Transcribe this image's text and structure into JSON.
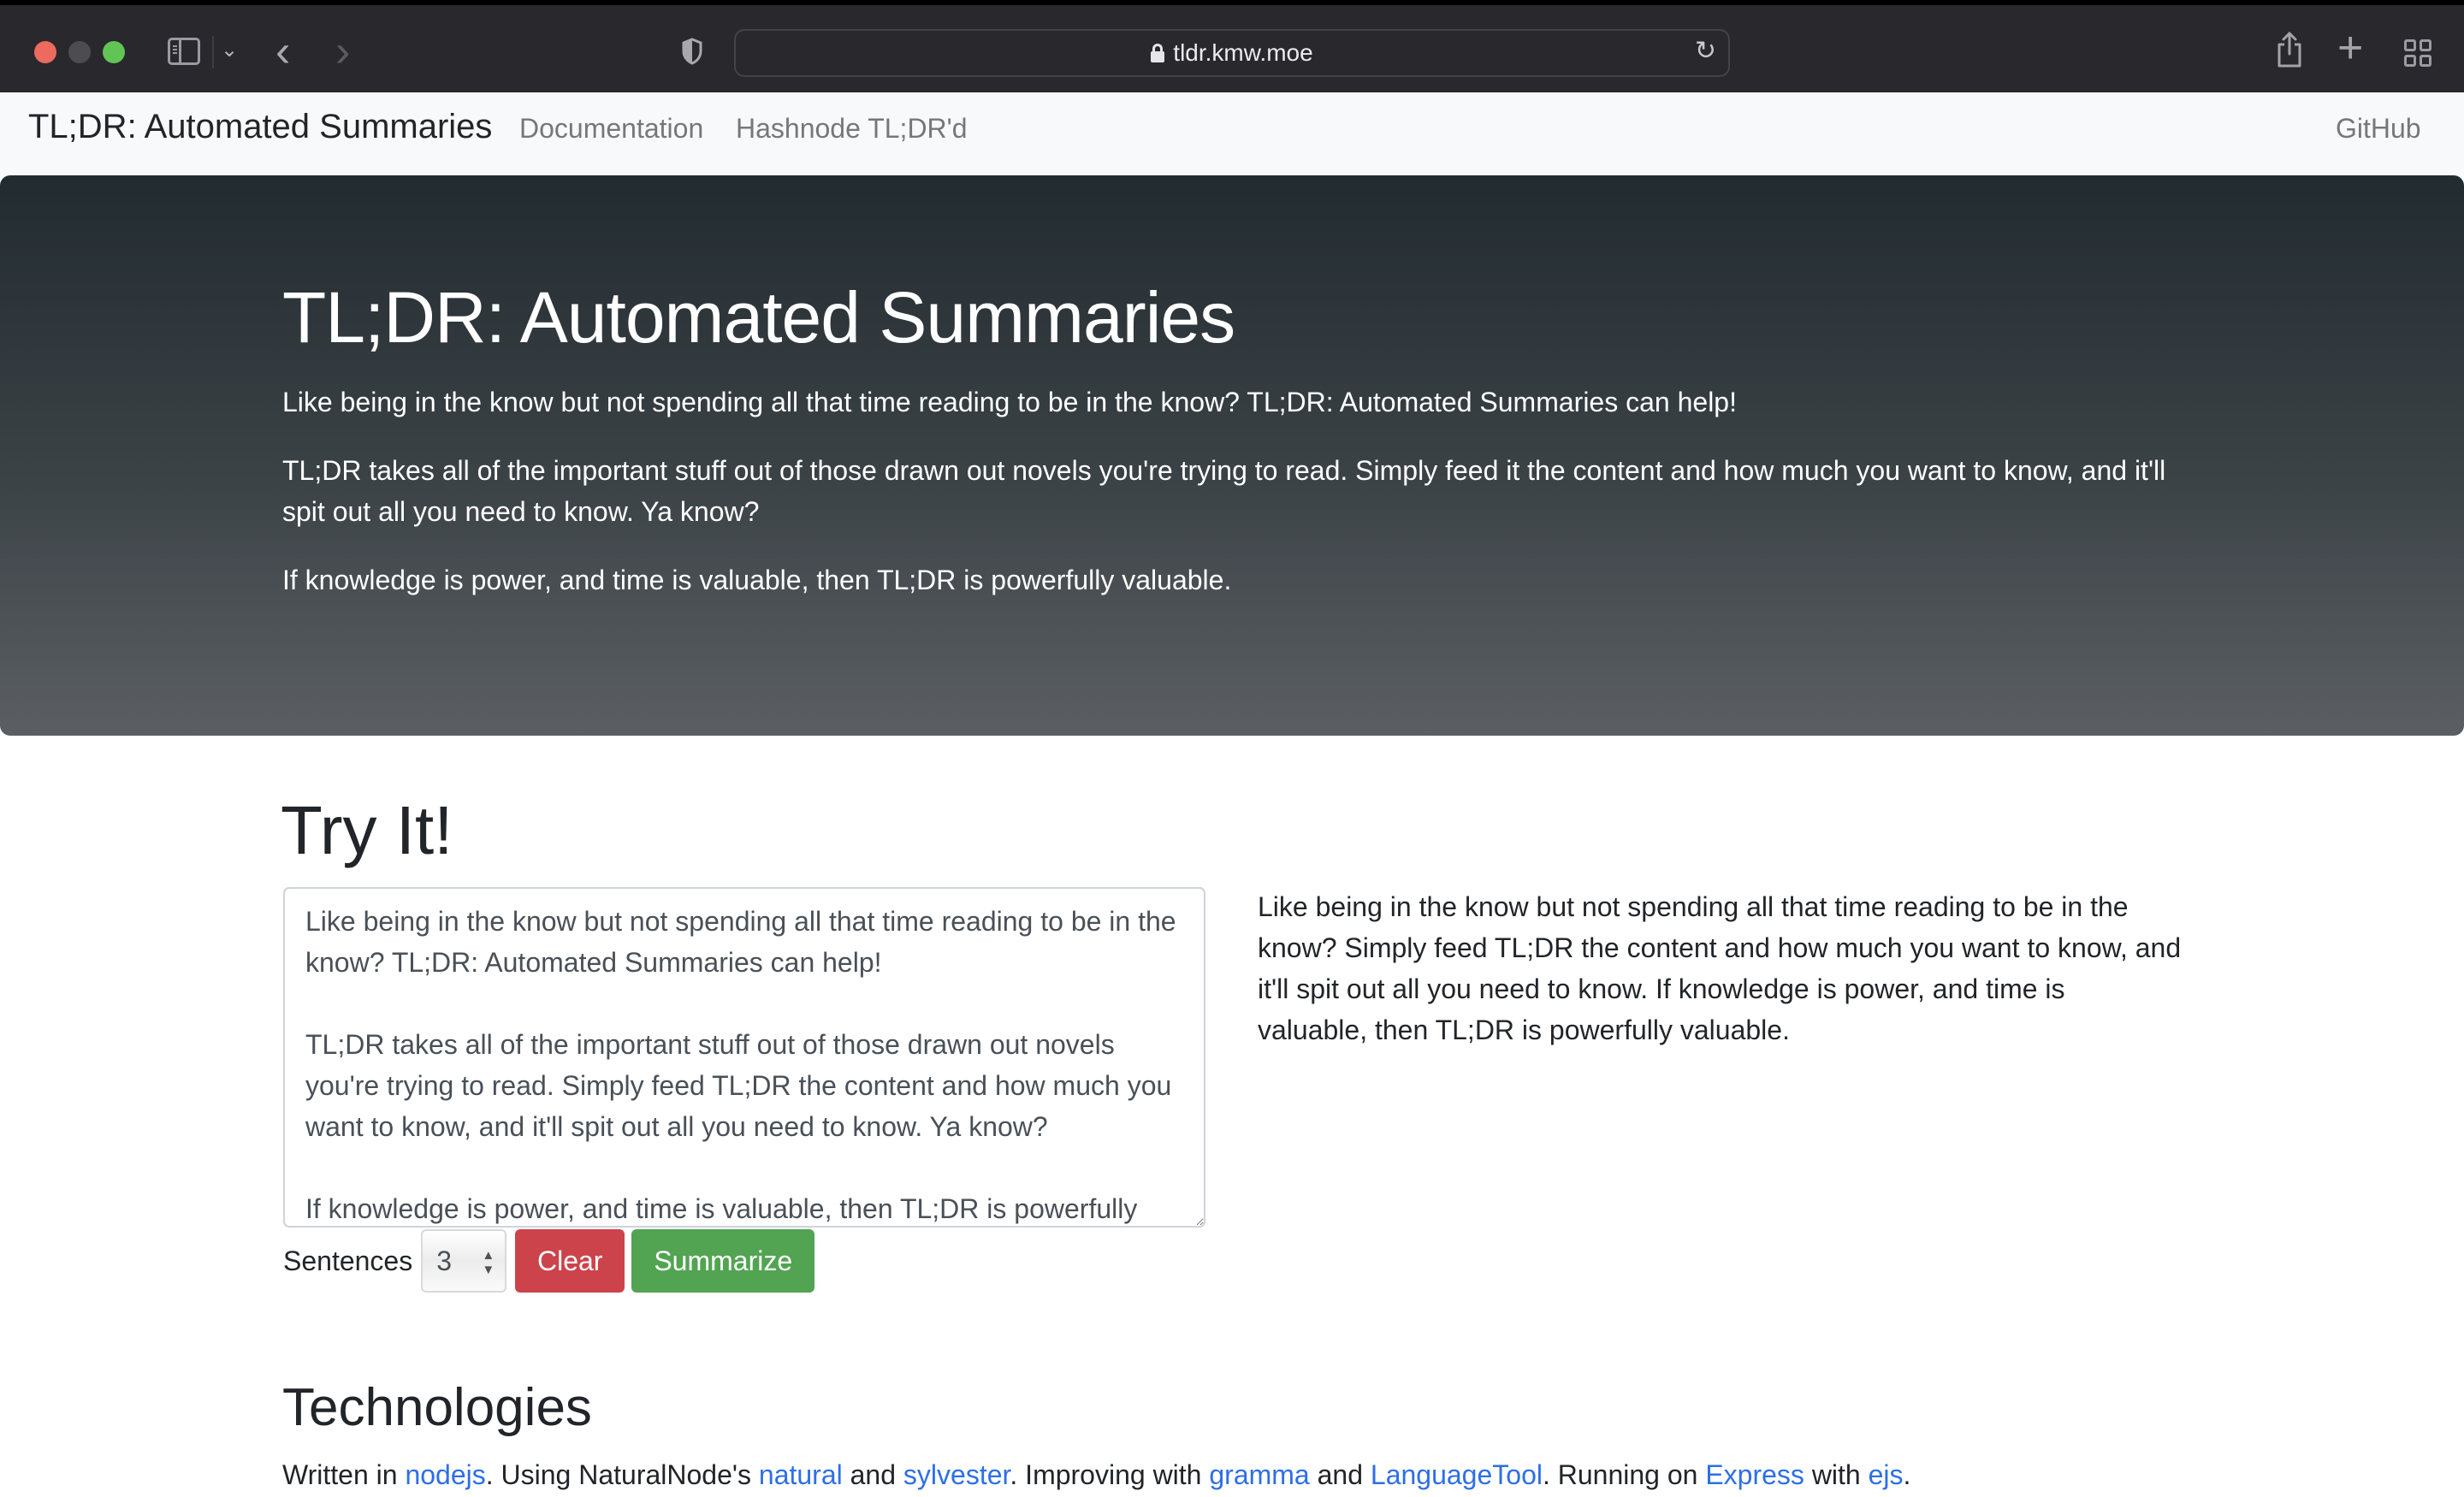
{
  "browser": {
    "url": "tldr.kmw.moe",
    "icons": [
      "sidebar-icon",
      "chevron-down-icon",
      "back-icon",
      "forward-icon",
      "shield-icon",
      "lock-icon",
      "reload-icon",
      "share-icon",
      "plus-icon",
      "tabs-overview-icon"
    ],
    "back_glyph": "‹",
    "forward_glyph": "›",
    "chevron_glyph": "⌄",
    "reload_glyph": "↻",
    "plus_glyph": "+"
  },
  "navbar": {
    "brand": "TL;DR: Automated Summaries",
    "links": [
      {
        "label": "Documentation"
      },
      {
        "label": "Hashnode TL;DR'd"
      }
    ],
    "github": "GitHub"
  },
  "hero": {
    "title": "TL;DR: Automated Summaries",
    "paragraphs": [
      "Like being in the know but not spending all that time reading to be in the know? TL;DR: Automated Summaries can help!",
      "TL;DR takes all of the important stuff out of those drawn out novels you're trying to read. Simply feed it the content and how much you want to know, and it'll spit out all you need to know. Ya know?",
      "If knowledge is power, and time is valuable, then TL;DR is powerfully valuable."
    ]
  },
  "try_it": {
    "title": "Try It!",
    "input_text": "Like being in the know but not spending all that time reading to be in the know? TL;DR: Automated Summaries can help!\n\nTL;DR takes all of the important stuff out of those drawn out novels you're trying to read. Simply feed TL;DR the content and how much you want to know, and it'll spit out all you need to know. Ya know?\n\nIf knowledge is power, and time is valuable, then TL;DR is powerfully valuable.",
    "summary": "Like being in the know but not spending all that time reading to be in the know? Simply feed TL;DR the content and how much you want to know, and it'll spit out all you need to know. If knowledge is power, and time is valuable, then TL;DR is powerfully valuable.",
    "sentences_label": "Sentences",
    "sentences_value": "3",
    "clear_label": "Clear",
    "summarize_label": "Summarize",
    "colors": {
      "clear": "#cd434b",
      "summarize": "#52a452"
    }
  },
  "technologies": {
    "title": "Technologies",
    "segments": [
      {
        "text": "Written in ",
        "link": false
      },
      {
        "text": "nodejs",
        "link": true
      },
      {
        "text": ". Using NaturalNode's ",
        "link": false
      },
      {
        "text": "natural",
        "link": true
      },
      {
        "text": " and ",
        "link": false
      },
      {
        "text": "sylvester",
        "link": true
      },
      {
        "text": ". Improving with ",
        "link": false
      },
      {
        "text": "gramma",
        "link": true
      },
      {
        "text": " and ",
        "link": false
      },
      {
        "text": "LanguageTool",
        "link": true
      },
      {
        "text": ". Running on ",
        "link": false
      },
      {
        "text": "Express",
        "link": true
      },
      {
        "text": " with ",
        "link": false
      },
      {
        "text": "ejs",
        "link": true
      },
      {
        "text": ".",
        "link": false
      }
    ],
    "link_color": "#2d6fe6"
  }
}
